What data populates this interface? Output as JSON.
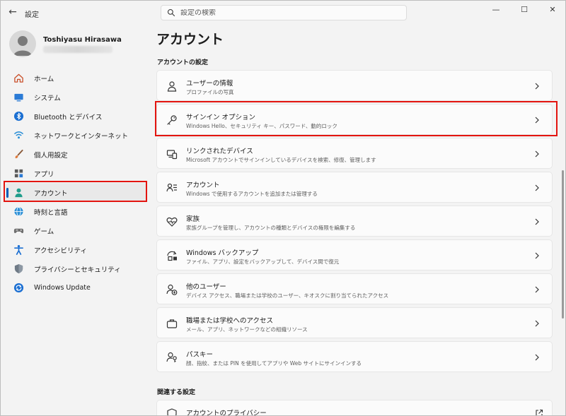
{
  "window": {
    "app_title": "設定",
    "controls": {
      "minimize": "—",
      "maximize": "☐",
      "close": "✕"
    }
  },
  "search": {
    "placeholder": "設定の検索",
    "value": ""
  },
  "profile": {
    "name": "Toshiyasu Hirasawa"
  },
  "sidebar": {
    "items": [
      {
        "label": "ホーム",
        "icon": "home-icon"
      },
      {
        "label": "システム",
        "icon": "system-icon"
      },
      {
        "label": "Bluetooth とデバイス",
        "icon": "bluetooth-icon"
      },
      {
        "label": "ネットワークとインターネット",
        "icon": "network-icon"
      },
      {
        "label": "個人用設定",
        "icon": "brush-icon"
      },
      {
        "label": "アプリ",
        "icon": "apps-icon"
      },
      {
        "label": "アカウント",
        "icon": "account-icon",
        "selected": true
      },
      {
        "label": "時刻と言語",
        "icon": "globe-icon"
      },
      {
        "label": "ゲーム",
        "icon": "gamepad-icon"
      },
      {
        "label": "アクセシビリティ",
        "icon": "accessibility-icon"
      },
      {
        "label": "プライバシーとセキュリティ",
        "icon": "shield-icon"
      },
      {
        "label": "Windows Update",
        "icon": "update-icon"
      }
    ]
  },
  "main": {
    "title": "アカウント",
    "section_account": "アカウントの設定",
    "cards": [
      {
        "title": "ユーザーの情報",
        "subtitle": "プロファイルの写真",
        "icon": "person-icon"
      },
      {
        "title": "サインイン オプション",
        "subtitle": "Windows Hello、セキュリティ キー、パスワード、動的ロック",
        "icon": "key-icon"
      },
      {
        "title": "リンクされたデバイス",
        "subtitle": "Microsoft アカウントでサインインしているデバイスを検索、修復、管理します",
        "icon": "linked-devices-icon"
      },
      {
        "title": "アカウント",
        "subtitle": "Windows で使用するアカウントを追加または管理する",
        "icon": "accounts-list-icon"
      },
      {
        "title": "家族",
        "subtitle": "家族グループを管理し、アカウントの種類とデバイスの権限を編集する",
        "icon": "heart-icon"
      },
      {
        "title": "Windows バックアップ",
        "subtitle": "ファイル、アプリ、設定をバックアップして、デバイス間で復元",
        "icon": "backup-icon"
      },
      {
        "title": "他のユーザー",
        "subtitle": "デバイス アクセス、職場または学校のユーザー、キオスクに割り当てられたアクセス",
        "icon": "add-user-icon"
      },
      {
        "title": "職場または学校へのアクセス",
        "subtitle": "メール、アプリ、ネットワークなどの組織リソース",
        "icon": "briefcase-icon"
      },
      {
        "title": "パスキー",
        "subtitle": "顔、指紋、または PIN を使用してアプリや Web サイトにサインインする",
        "icon": "passkey-icon"
      }
    ],
    "section_related": "関連する設定",
    "related_cards": [
      {
        "title": "アカウントのプライバシー",
        "icon": "shield-outline-icon"
      }
    ]
  },
  "colors": {
    "accent": "#005fb8",
    "highlight": "#e3140f"
  }
}
